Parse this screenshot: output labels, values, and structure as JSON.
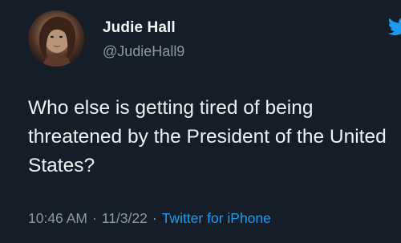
{
  "tweet": {
    "author": {
      "display_name": "Judie Hall",
      "handle": "@JudieHall9",
      "avatar_icon": "profile-photo"
    },
    "text": "Who else is getting tired of being threatened by the President of the United States?",
    "time": "10:46 AM",
    "separator": "·",
    "date": "11/3/22",
    "source": "Twitter for iPhone"
  },
  "colors": {
    "background": "#141d28",
    "text": "#eef1f3",
    "secondary_text": "#8b98a5",
    "accent": "#1d9bf0"
  },
  "icons": {
    "brand": "twitter-bird-icon"
  }
}
